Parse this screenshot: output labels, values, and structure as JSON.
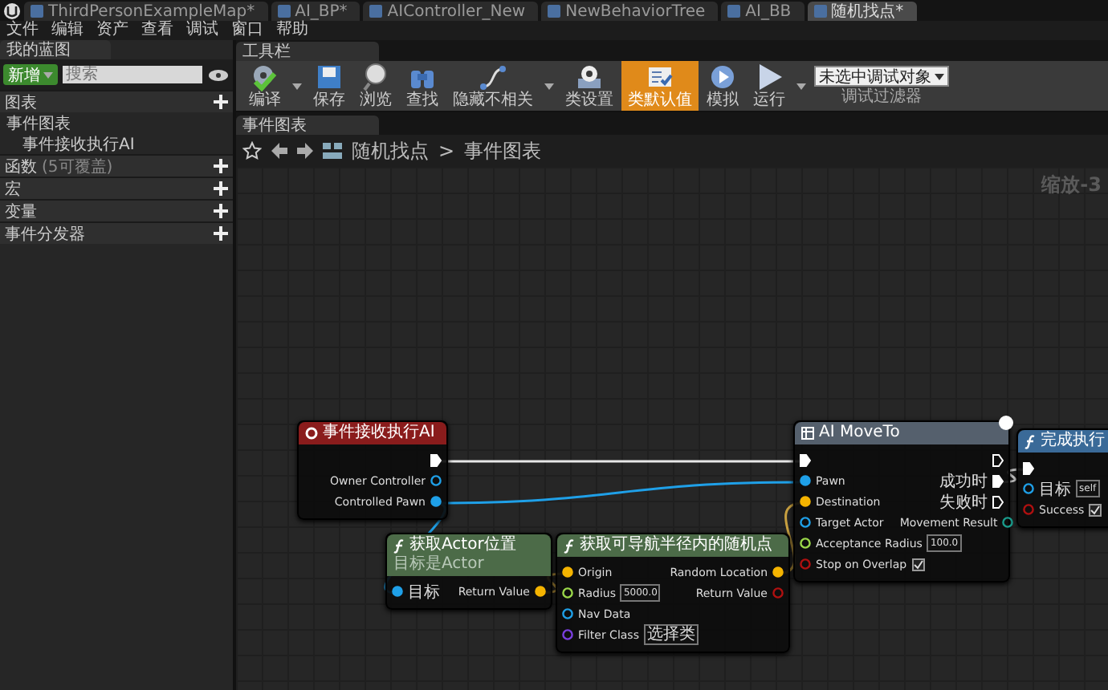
{
  "tabs": [
    {
      "label": "ThirdPersonExampleMap*",
      "selected": false
    },
    {
      "label": "AI_BP*",
      "selected": false
    },
    {
      "label": "AIController_New",
      "selected": false
    },
    {
      "label": "NewBehaviorTree",
      "selected": false
    },
    {
      "label": "AI_BB",
      "selected": false
    },
    {
      "label": "随机找点*",
      "selected": true
    }
  ],
  "menu": [
    "文件",
    "编辑",
    "资产",
    "查看",
    "调试",
    "窗口",
    "帮助"
  ],
  "my_blueprint": {
    "title": "我的蓝图",
    "add_button": "新增",
    "search": {
      "placeholder": "搜索"
    },
    "sections": [
      {
        "label": "图表",
        "items": [
          {
            "label": "事件图表",
            "children": [
              {
                "label": "事件接收执行AI"
              }
            ]
          }
        ]
      },
      {
        "label": "函数",
        "note": "(5可覆盖)"
      },
      {
        "label": "宏"
      },
      {
        "label": "变量"
      },
      {
        "label": "事件分发器"
      }
    ]
  },
  "toolbar": {
    "title": "工具栏",
    "buttons": [
      {
        "kind": "compile",
        "label": "编译",
        "selected": false,
        "dropdown": true
      },
      {
        "kind": "save",
        "label": "保存",
        "selected": false
      },
      {
        "kind": "browse",
        "label": "浏览",
        "selected": false
      },
      {
        "kind": "find",
        "label": "查找",
        "selected": false
      },
      {
        "kind": "hide",
        "label": "隐藏不相关",
        "selected": false,
        "dropdown": true
      },
      {
        "kind": "settings",
        "label": "类设置",
        "selected": false
      },
      {
        "kind": "defaults",
        "label": "类默认值",
        "selected": true
      },
      {
        "kind": "simulate",
        "label": "模拟",
        "selected": false
      },
      {
        "kind": "play",
        "label": "运行",
        "selected": false,
        "dropdown": true
      }
    ],
    "debug_filter": {
      "value": "未选中调试对象",
      "label": "调试过滤器"
    }
  },
  "graph": {
    "tab": "事件图表",
    "breadcrumb": [
      "随机找点",
      "事件图表"
    ],
    "separator": ">",
    "zoom": "缩放-3",
    "nodes": [
      {
        "kind": "event",
        "color": "#8a1c1c",
        "title": "事件接收执行AI",
        "outputs": [
          {
            "kind": "exec",
            "connected": true
          },
          {
            "label": "Owner Controller",
            "kind": "object",
            "connected": false
          },
          {
            "label": "Controlled Pawn",
            "kind": "object",
            "connected": true
          }
        ]
      },
      {
        "kind": "function",
        "color": "#4c6b48",
        "title": "获取Actor位置",
        "subtitle": "目标是Actor",
        "inputs": [
          {
            "label": "目标",
            "kind": "object",
            "connected": true
          }
        ],
        "outputs": [
          {
            "label": "Return Value",
            "kind": "vector",
            "connected": true
          }
        ]
      },
      {
        "kind": "function",
        "color": "#4c6b48",
        "title": "获取可导航半径内的随机点",
        "inputs": [
          {
            "label": "Origin",
            "kind": "vector",
            "connected": true
          },
          {
            "label": "Radius",
            "kind": "float",
            "connected": false,
            "value": "5000.0"
          },
          {
            "label": "Nav Data",
            "kind": "object",
            "connected": false
          },
          {
            "label": "Filter Class",
            "kind": "class",
            "connected": false,
            "value": "选择类"
          }
        ],
        "outputs": [
          {
            "label": "Random Location",
            "kind": "vector",
            "connected": true
          },
          {
            "label": "Return Value",
            "kind": "bool",
            "connected": false
          }
        ]
      },
      {
        "kind": "latent",
        "color": "#55606d",
        "title": "AI MoveTo",
        "inputs": [
          {
            "kind": "exec",
            "connected": true
          },
          {
            "label": "Pawn",
            "kind": "object",
            "connected": true
          },
          {
            "label": "Destination",
            "kind": "vector",
            "connected": true
          },
          {
            "label": "Target Actor",
            "kind": "object",
            "connected": false
          },
          {
            "label": "Acceptance Radius",
            "kind": "float",
            "connected": false,
            "value": "100.0"
          },
          {
            "label": "Stop on Overlap",
            "kind": "bool",
            "connected": false,
            "checked": true
          }
        ],
        "outputs": [
          {
            "kind": "exec",
            "connected": false
          },
          {
            "label": "成功时",
            "kind": "exec",
            "connected": true
          },
          {
            "label": "失败时",
            "kind": "exec",
            "connected": false
          },
          {
            "label": "Movement Result",
            "kind": "enum",
            "connected": false
          }
        ]
      },
      {
        "kind": "function",
        "color": "#3a6a98",
        "title": "完成执行",
        "inputs": [
          {
            "kind": "exec",
            "connected": true
          },
          {
            "label": "目标",
            "kind": "object",
            "connected": false,
            "value": "self"
          },
          {
            "label": "Success",
            "kind": "bool",
            "connected": false,
            "checked": true
          }
        ]
      }
    ]
  }
}
